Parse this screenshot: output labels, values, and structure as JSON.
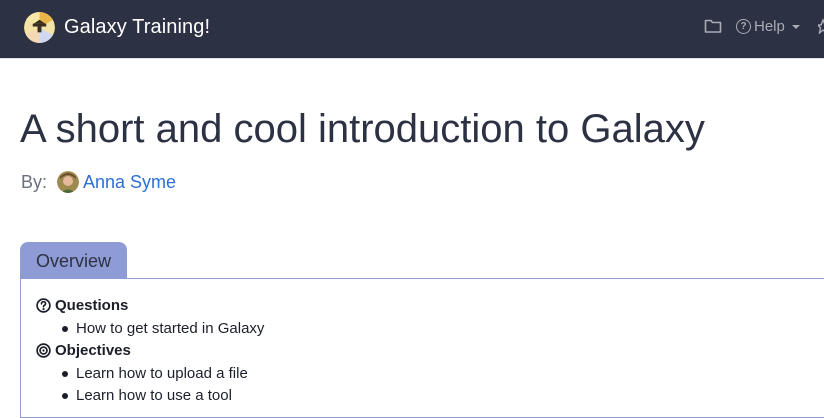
{
  "navbar": {
    "brand": "Galaxy Training!",
    "folder_icon": "folder-icon",
    "help_label": "Help",
    "bg_color": "#2c3143"
  },
  "page": {
    "title": "A short and cool introduction to Galaxy",
    "by_label": "By:",
    "author": "Anna Syme"
  },
  "tabs": [
    {
      "label": "Overview",
      "active": true
    }
  ],
  "overview": {
    "questions_label": "Questions",
    "questions": [
      "How to get started in Galaxy"
    ],
    "objectives_label": "Objectives",
    "objectives": [
      "Learn how to upload a file",
      "Learn how to use a tool"
    ]
  },
  "colors": {
    "accent": "#8f9bd4",
    "link": "#2c6fd6",
    "text": "#2c3143"
  }
}
